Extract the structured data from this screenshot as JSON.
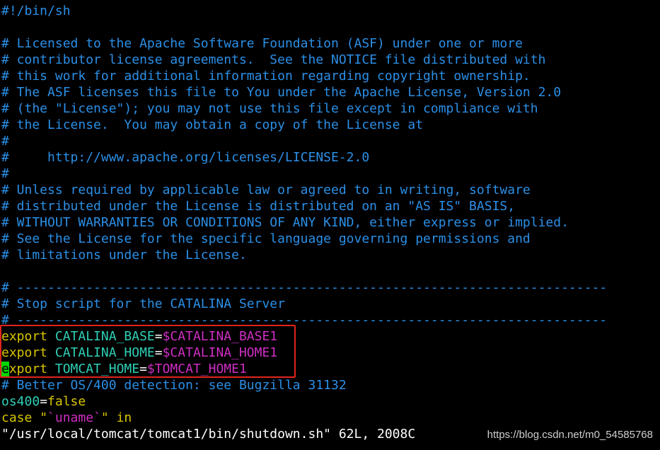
{
  "editor": {
    "lines": [
      {
        "parts": [
          {
            "t": "#!/bin/sh",
            "c": "comment"
          }
        ]
      },
      {
        "parts": [
          {
            "t": "",
            "c": "comment"
          }
        ]
      },
      {
        "parts": [
          {
            "t": "# Licensed to the Apache Software Foundation (ASF) under one or more",
            "c": "comment"
          }
        ]
      },
      {
        "parts": [
          {
            "t": "# contributor license agreements.  See the NOTICE file distributed with",
            "c": "comment"
          }
        ]
      },
      {
        "parts": [
          {
            "t": "# this work for additional information regarding copyright ownership.",
            "c": "comment"
          }
        ]
      },
      {
        "parts": [
          {
            "t": "# The ASF licenses this file to You under the Apache License, Version 2.0",
            "c": "comment"
          }
        ]
      },
      {
        "parts": [
          {
            "t": "# (the \"License\"); you may not use this file except in compliance with",
            "c": "comment"
          }
        ]
      },
      {
        "parts": [
          {
            "t": "# the License.  You may obtain a copy of the License at",
            "c": "comment"
          }
        ]
      },
      {
        "parts": [
          {
            "t": "#",
            "c": "comment"
          }
        ]
      },
      {
        "parts": [
          {
            "t": "#     http://www.apache.org/licenses/LICENSE-2.0",
            "c": "comment"
          }
        ]
      },
      {
        "parts": [
          {
            "t": "#",
            "c": "comment"
          }
        ]
      },
      {
        "parts": [
          {
            "t": "# Unless required by applicable law or agreed to in writing, software",
            "c": "comment"
          }
        ]
      },
      {
        "parts": [
          {
            "t": "# distributed under the License is distributed on an \"AS IS\" BASIS,",
            "c": "comment"
          }
        ]
      },
      {
        "parts": [
          {
            "t": "# WITHOUT WARRANTIES OR CONDITIONS OF ANY KIND, either express or implied.",
            "c": "comment"
          }
        ]
      },
      {
        "parts": [
          {
            "t": "# See the License for the specific language governing permissions and",
            "c": "comment"
          }
        ]
      },
      {
        "parts": [
          {
            "t": "# limitations under the License.",
            "c": "comment"
          }
        ]
      },
      {
        "parts": [
          {
            "t": "",
            "c": "comment"
          }
        ]
      },
      {
        "parts": [
          {
            "t": "# -----------------------------------------------------------------------------",
            "c": "comment"
          }
        ]
      },
      {
        "parts": [
          {
            "t": "# Stop script for the CATALINA Server",
            "c": "comment"
          }
        ]
      },
      {
        "parts": [
          {
            "t": "# -----------------------------------------------------------------------------",
            "c": "comment"
          }
        ]
      },
      {
        "parts": [
          {
            "t": "export",
            "c": "kw-export"
          },
          {
            "t": " CATALINA_BASE",
            "c": "var"
          },
          {
            "t": "=",
            "c": "op"
          },
          {
            "t": "$CATALINA_BASE1",
            "c": "val"
          }
        ]
      },
      {
        "parts": [
          {
            "t": "export",
            "c": "kw-export"
          },
          {
            "t": " CATALINA_HOME",
            "c": "var"
          },
          {
            "t": "=",
            "c": "op"
          },
          {
            "t": "$CATALINA_HOME1",
            "c": "val"
          }
        ]
      },
      {
        "parts": [
          {
            "t": "e",
            "c": "cursor"
          },
          {
            "t": "xport",
            "c": "kw-export"
          },
          {
            "t": " TOMCAT_HOME",
            "c": "var"
          },
          {
            "t": "=",
            "c": "op"
          },
          {
            "t": "$TOMCAT_HOME1",
            "c": "val"
          }
        ]
      },
      {
        "parts": [
          {
            "t": "# Better OS/400 detection: see Bugzilla 31132",
            "c": "comment"
          }
        ]
      },
      {
        "parts": [
          {
            "t": "os400",
            "c": "var"
          },
          {
            "t": "=",
            "c": "op"
          },
          {
            "t": "false",
            "c": "str"
          }
        ]
      },
      {
        "parts": [
          {
            "t": "case",
            "c": "kw-case"
          },
          {
            "t": " ",
            "c": "op"
          },
          {
            "t": "\"",
            "c": "str"
          },
          {
            "t": "`uname`",
            "c": "cmd"
          },
          {
            "t": "\"",
            "c": "str"
          },
          {
            "t": " in",
            "c": "kw-case"
          }
        ]
      },
      {
        "parts": [
          {
            "t": "\"/usr/local/tomcat/tomcat1/bin/shutdown.sh\" 62L, 2008C",
            "c": "status"
          }
        ]
      }
    ]
  },
  "watermark": "https://blog.csdn.net/m0_54585768",
  "colors": {
    "background": "#000000",
    "comment": "#2b8fe6",
    "keyword": "#d8c400",
    "variable": "#2fd0b7",
    "value": "#d02ec4",
    "cursor": "#00d700",
    "highlight_border": "#e0241d"
  }
}
